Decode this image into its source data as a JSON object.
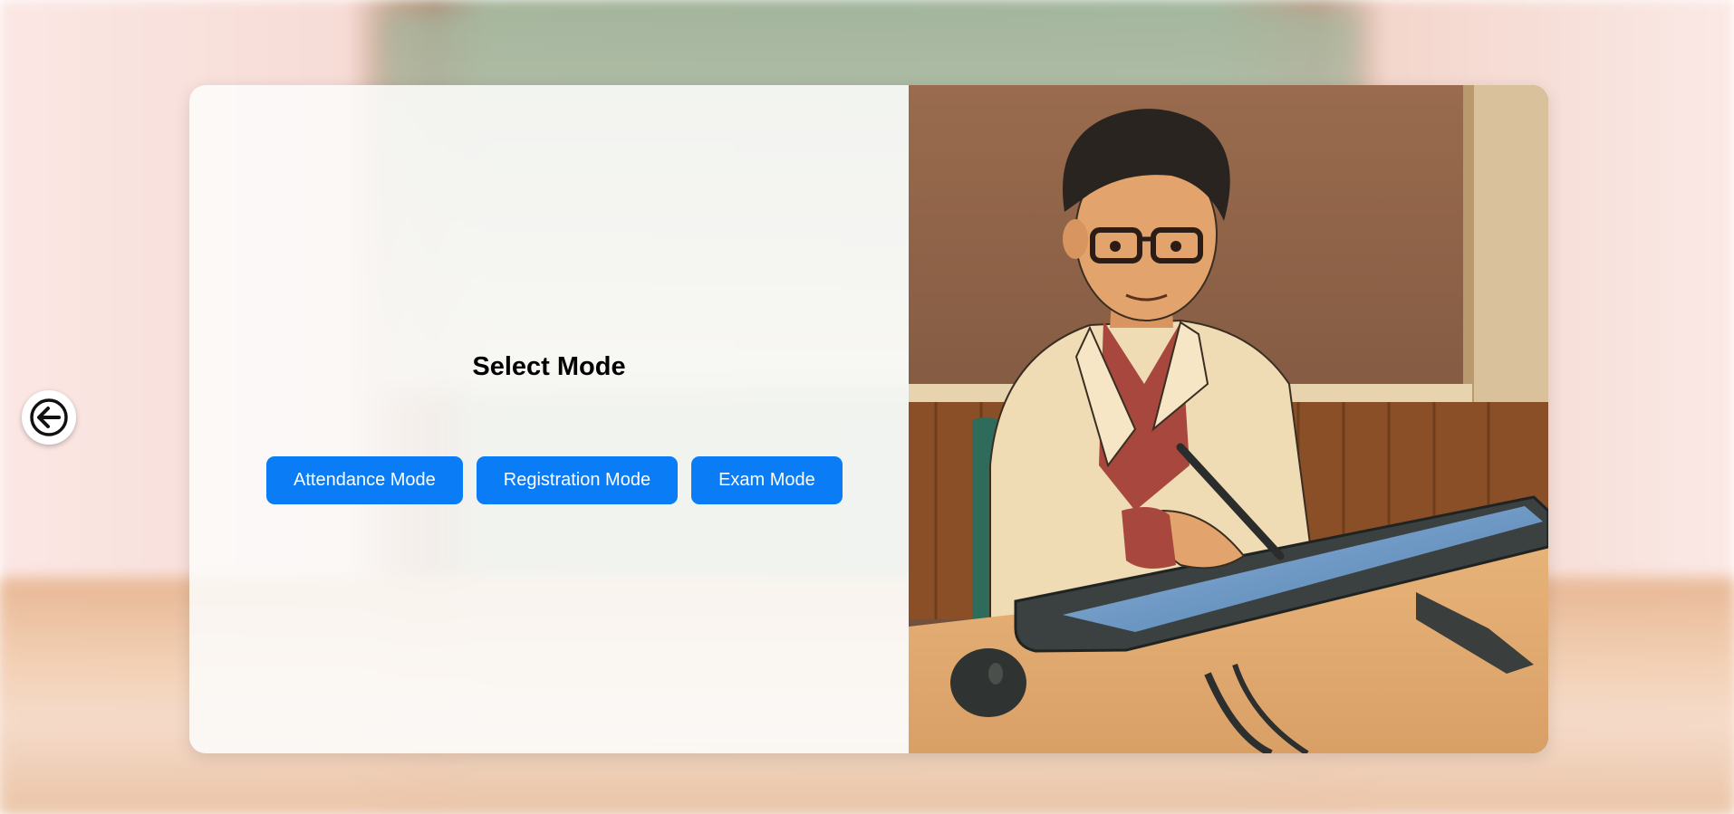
{
  "page": {
    "title": "Select Mode"
  },
  "back_button": {
    "icon": "arrow-left-circle-icon"
  },
  "modes": [
    {
      "label": "Attendance Mode"
    },
    {
      "label": "Registration Mode"
    },
    {
      "label": "Exam Mode"
    }
  ],
  "colors": {
    "primary_button": "#0a7cf5",
    "button_text": "#ffffff",
    "title_text": "#000000"
  },
  "illustration": {
    "subject": "teacher-at-drawing-tablet-illustration"
  }
}
